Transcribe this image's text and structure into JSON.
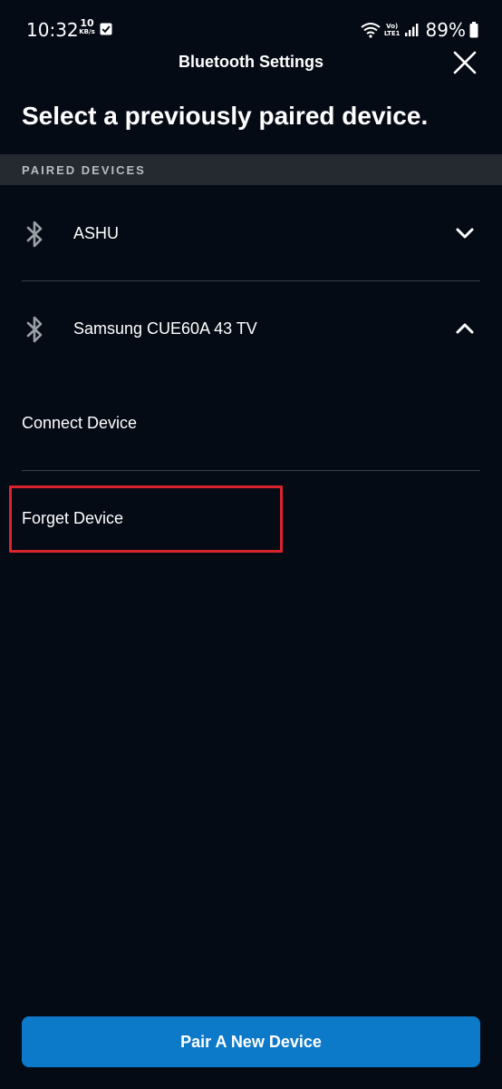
{
  "status_bar": {
    "time": "10:32",
    "net_speed_value": "10",
    "net_speed_unit": "KB/s",
    "volte_line1": "Vo)",
    "volte_line2": "LTE1",
    "battery_percent": "89%"
  },
  "header": {
    "title": "Bluetooth Settings"
  },
  "main": {
    "heading": "Select a previously paired device.",
    "section_label": "PAIRED DEVICES",
    "devices": [
      {
        "name": "ASHU",
        "expanded": false
      },
      {
        "name": "Samsung CUE60A 43 TV",
        "expanded": true
      }
    ],
    "actions": {
      "connect": "Connect Device",
      "forget": "Forget Device"
    }
  },
  "footer": {
    "pair_button": "Pair A New Device"
  },
  "colors": {
    "background": "#050b15",
    "section_bg": "#252a30",
    "accent_button": "#0c79c9",
    "highlight": "#d9242c"
  },
  "icons": {
    "close": "close-icon",
    "bluetooth": "bluetooth-icon",
    "chevron_down": "chevron-down-icon",
    "chevron_up": "chevron-up-icon"
  }
}
